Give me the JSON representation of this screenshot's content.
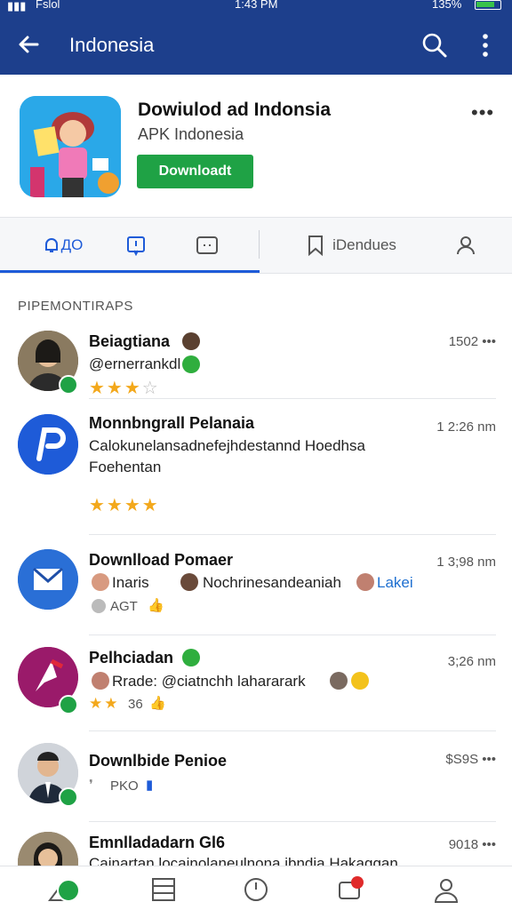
{
  "status_bar": {
    "carrier": "Fslol",
    "time": "1:43 PM",
    "battery": "135%"
  },
  "app_bar": {
    "title": "Indonesia",
    "icons": [
      "back-arrow-icon",
      "search-icon",
      "more-vertical-icon"
    ]
  },
  "app_header": {
    "name": "Dowiulod ad Indonsia",
    "subtitle": "APK Indonesia",
    "download_label": "Downloadt",
    "more_label": "•••"
  },
  "tabs": [
    {
      "label": "ДО",
      "icon": "bell-icon",
      "active": true
    },
    {
      "label": "",
      "icon": "message-icon",
      "active": false
    },
    {
      "label": "",
      "icon": "chat-icon",
      "active": false
    },
    {
      "label": "iDendues",
      "icon": "bookmark-icon",
      "active": false
    },
    {
      "label": "",
      "icon": "user-icon",
      "active": false
    }
  ],
  "section_title": "PIPEMONTIRAPS",
  "items": [
    {
      "title": "Beiagtiana",
      "line1": "@ernerrankdl",
      "time": "1502 •••",
      "stars_filled": 3,
      "stars_total": 4
    },
    {
      "title": "Monnbngrall Pelanaia",
      "line1": "Calokunelansadnefejhdestannd Hoedhsa",
      "line2": "Foehentan",
      "time": "1 2:26 nm",
      "stars_filled": 4,
      "stars_total": 4
    },
    {
      "title": "Downlload Pomaer",
      "line1_a": "Inaris",
      "line1_b": "Nochrinesandeaniah",
      "line1_link": "Lakei",
      "meta": "AGT",
      "time": "1 3;98 nm"
    },
    {
      "title": "Pelhciadan",
      "line1": "Rrade: @ciatnchh lahararark",
      "meta": "36",
      "time": "3;26 nm",
      "stars_filled": 2,
      "stars_total": 2
    },
    {
      "title": "Downlbide Penioe",
      "meta": "PKO",
      "time": "$S9S •••"
    },
    {
      "title": "Emnlladadarn Gl6",
      "line1": "Cainartan locainolaneulnona ibndia Hakaggan",
      "time": "9018 •••"
    }
  ],
  "bottom_nav": [
    "home-icon",
    "list-icon",
    "clock-icon",
    "notifications-icon",
    "profile-icon"
  ],
  "colors": {
    "primary": "#1d3f8c",
    "accent": "#1e5bd8",
    "download": "#1fa245",
    "star": "#f3a81b"
  }
}
